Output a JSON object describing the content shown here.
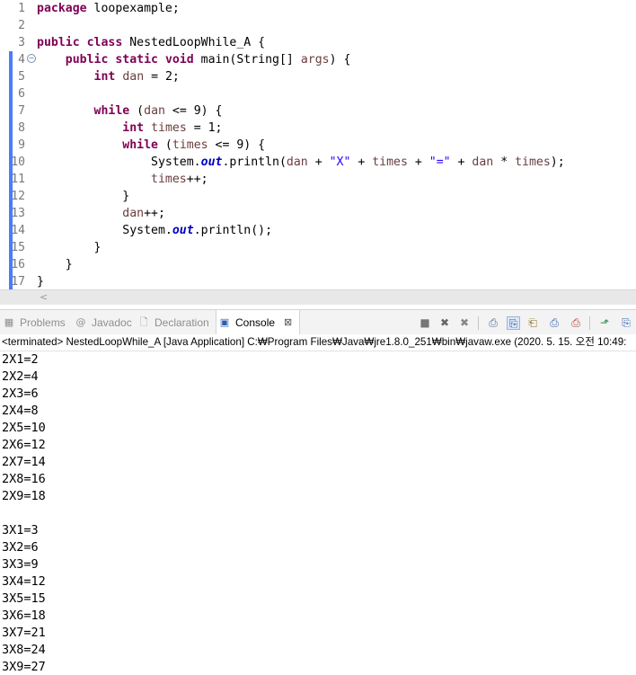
{
  "editor": {
    "lines": [
      {
        "num": "1",
        "fold": false,
        "cov": false,
        "tokens": [
          {
            "t": "package",
            "c": "kw"
          },
          {
            "t": " loopexample;"
          }
        ]
      },
      {
        "num": "2",
        "fold": false,
        "cov": false,
        "tokens": []
      },
      {
        "num": "3",
        "fold": false,
        "cov": false,
        "tokens": [
          {
            "t": "public",
            "c": "kw"
          },
          {
            "t": " "
          },
          {
            "t": "class",
            "c": "kw"
          },
          {
            "t": " NestedLoopWhile_A {"
          }
        ]
      },
      {
        "num": "4",
        "fold": true,
        "cov": true,
        "tokens": [
          {
            "t": "    "
          },
          {
            "t": "public",
            "c": "kw"
          },
          {
            "t": " "
          },
          {
            "t": "static",
            "c": "kw"
          },
          {
            "t": " "
          },
          {
            "t": "void",
            "c": "kw"
          },
          {
            "t": " main(String[] "
          },
          {
            "t": "args",
            "c": "var"
          },
          {
            "t": ") {"
          }
        ]
      },
      {
        "num": "5",
        "fold": false,
        "cov": true,
        "tokens": [
          {
            "t": "        "
          },
          {
            "t": "int",
            "c": "kw"
          },
          {
            "t": " "
          },
          {
            "t": "dan",
            "c": "var"
          },
          {
            "t": " = 2;"
          }
        ]
      },
      {
        "num": "6",
        "fold": false,
        "cov": true,
        "tokens": []
      },
      {
        "num": "7",
        "fold": false,
        "cov": true,
        "tokens": [
          {
            "t": "        "
          },
          {
            "t": "while",
            "c": "kw"
          },
          {
            "t": " ("
          },
          {
            "t": "dan",
            "c": "var"
          },
          {
            "t": " <= 9) {"
          }
        ]
      },
      {
        "num": "8",
        "fold": false,
        "cov": true,
        "tokens": [
          {
            "t": "            "
          },
          {
            "t": "int",
            "c": "kw"
          },
          {
            "t": " "
          },
          {
            "t": "times",
            "c": "var"
          },
          {
            "t": " = 1;"
          }
        ]
      },
      {
        "num": "9",
        "fold": false,
        "cov": true,
        "tokens": [
          {
            "t": "            "
          },
          {
            "t": "while",
            "c": "kw"
          },
          {
            "t": " ("
          },
          {
            "t": "times",
            "c": "var"
          },
          {
            "t": " <= 9) {"
          }
        ]
      },
      {
        "num": "10",
        "fold": false,
        "cov": true,
        "tokens": [
          {
            "t": "                System."
          },
          {
            "t": "out",
            "c": "fld"
          },
          {
            "t": ".println("
          },
          {
            "t": "dan",
            "c": "var"
          },
          {
            "t": " + "
          },
          {
            "t": "\"X\"",
            "c": "str"
          },
          {
            "t": " + "
          },
          {
            "t": "times",
            "c": "var"
          },
          {
            "t": " + "
          },
          {
            "t": "\"=\"",
            "c": "str"
          },
          {
            "t": " + "
          },
          {
            "t": "dan",
            "c": "var"
          },
          {
            "t": " * "
          },
          {
            "t": "times",
            "c": "var"
          },
          {
            "t": ");"
          }
        ]
      },
      {
        "num": "11",
        "fold": false,
        "cov": true,
        "tokens": [
          {
            "t": "                "
          },
          {
            "t": "times",
            "c": "var"
          },
          {
            "t": "++;"
          }
        ]
      },
      {
        "num": "12",
        "fold": false,
        "cov": true,
        "tokens": [
          {
            "t": "            }"
          }
        ]
      },
      {
        "num": "13",
        "fold": false,
        "cov": true,
        "tokens": [
          {
            "t": "            "
          },
          {
            "t": "dan",
            "c": "var"
          },
          {
            "t": "++;"
          }
        ]
      },
      {
        "num": "14",
        "fold": false,
        "cov": true,
        "tokens": [
          {
            "t": "            System."
          },
          {
            "t": "out",
            "c": "fld"
          },
          {
            "t": ".println();"
          }
        ]
      },
      {
        "num": "15",
        "fold": false,
        "cov": true,
        "tokens": [
          {
            "t": "        }"
          }
        ]
      },
      {
        "num": "16",
        "fold": false,
        "cov": true,
        "tokens": [
          {
            "t": "    }"
          }
        ]
      },
      {
        "num": "17",
        "fold": false,
        "cov": true,
        "tokens": [
          {
            "t": "}"
          }
        ]
      }
    ],
    "scroll_left_arrow": "<"
  },
  "views": {
    "tabs": [
      {
        "id": "problems",
        "label": "Problems",
        "icon": "▦",
        "active": false
      },
      {
        "id": "javadoc",
        "label": "Javadoc",
        "icon": "@",
        "active": false
      },
      {
        "id": "declaration",
        "label": "Declaration",
        "icon": "🗋",
        "active": false
      },
      {
        "id": "console",
        "label": "Console",
        "icon": "▣",
        "active": true,
        "close": "⊠"
      }
    ],
    "toolbar": [
      "■",
      "✖",
      "✖",
      "⎙",
      "⎘",
      "⎗",
      "⎙",
      "⎙",
      "⎘",
      "⬏",
      "⎘"
    ]
  },
  "console": {
    "status": "<terminated> NestedLoopWhile_A [Java Application] C:₩Program Files₩Java₩jre1.8.0_251₩bin₩javaw.exe  (2020. 5. 15. 오전 10:49:",
    "output": [
      "2X1=2",
      "2X2=4",
      "2X3=6",
      "2X4=8",
      "2X5=10",
      "2X6=12",
      "2X7=14",
      "2X8=16",
      "2X9=18",
      "",
      "3X1=3",
      "3X2=6",
      "3X3=9",
      "3X4=12",
      "3X5=15",
      "3X6=18",
      "3X7=21",
      "3X8=24",
      "3X9=27"
    ]
  }
}
